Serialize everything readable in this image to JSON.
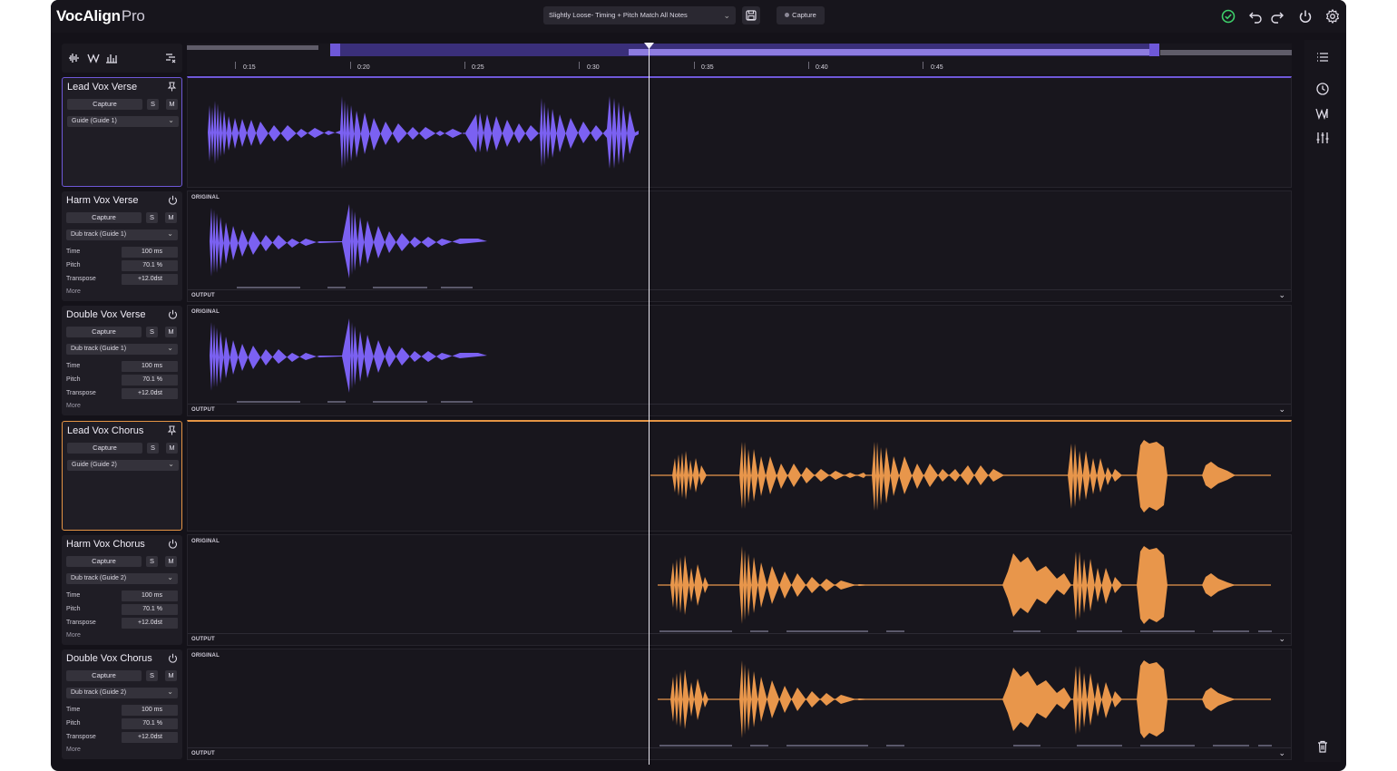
{
  "app": {
    "brand": "VocAlign",
    "suffix": "Pro"
  },
  "toolbar": {
    "preset": "Slightly Loose- Timing + Pitch Match All Notes",
    "capture_label": "Capture"
  },
  "ruler": {
    "labels": [
      "0:15",
      "0:20",
      "0:25",
      "0:30",
      "0:35",
      "0:40",
      "0:45"
    ]
  },
  "colors": {
    "guide1": "#7b61f2",
    "guide2": "#e8964b",
    "background": "#141219"
  },
  "tracks": [
    {
      "name": "Lead Vox Verse",
      "capture": "Capture",
      "solo": "S",
      "mute": "M",
      "source": "Guide (Guide 1)",
      "icon": "pin-icon"
    },
    {
      "name": "Harm Vox Verse",
      "capture": "Capture",
      "solo": "S",
      "mute": "M",
      "source": "Dub track (Guide 1)",
      "icon": "power-icon",
      "time_label": "Time",
      "time_value": "100 ms",
      "pitch_label": "Pitch",
      "pitch_value": "70.1 %",
      "transpose_label": "Transpose",
      "transpose_value": "+12.0dst",
      "more": "More"
    },
    {
      "name": "Double Vox Verse",
      "capture": "Capture",
      "solo": "S",
      "mute": "M",
      "source": "Dub track (Guide 1)",
      "icon": "power-icon",
      "time_label": "Time",
      "time_value": "100 ms",
      "pitch_label": "Pitch",
      "pitch_value": "70.1 %",
      "transpose_label": "Transpose",
      "transpose_value": "+12.0dst",
      "more": "More"
    },
    {
      "name": "Lead Vox Chorus",
      "capture": "Capture",
      "solo": "S",
      "mute": "M",
      "source": "Guide (Guide 2)",
      "icon": "pin-icon"
    },
    {
      "name": "Harm Vox Chorus",
      "capture": "Capture",
      "solo": "S",
      "mute": "M",
      "source": "Dub track (Guide 2)",
      "icon": "power-icon",
      "time_label": "Time",
      "time_value": "100 ms",
      "pitch_label": "Pitch",
      "pitch_value": "70.1 %",
      "transpose_label": "Transpose",
      "transpose_value": "+12.0dst",
      "more": "More"
    },
    {
      "name": "Double Vox Chorus",
      "capture": "Capture",
      "solo": "S",
      "mute": "M",
      "source": "Dub track (Guide 2)",
      "icon": "power-icon",
      "time_label": "Time",
      "time_value": "100 ms",
      "pitch_label": "Pitch",
      "pitch_value": "70.1 %",
      "transpose_label": "Transpose",
      "transpose_value": "+12.0dst",
      "more": "More"
    }
  ],
  "lanes": {
    "original_label": "ORIGINAL",
    "output_label": "OUTPUT"
  }
}
